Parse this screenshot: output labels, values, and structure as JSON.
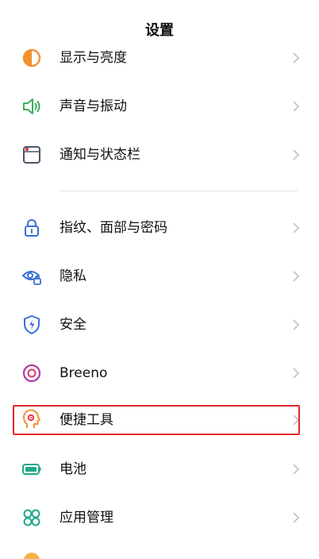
{
  "header": {
    "title": "设置"
  },
  "items": [
    {
      "label": "显示与亮度",
      "icon": "display-brightness-icon",
      "color": "#f2922e"
    },
    {
      "label": "声音与振动",
      "icon": "speaker-icon",
      "color": "#3daa5c"
    },
    {
      "label": "通知与状态栏",
      "icon": "notification-icon",
      "color": "#4a5666"
    },
    {
      "label": "指纹、面部与密码",
      "icon": "lock-icon",
      "color": "#3b6fd6"
    },
    {
      "label": "隐私",
      "icon": "privacy-eye-icon",
      "color": "#3b6fd6"
    },
    {
      "label": "安全",
      "icon": "security-shield-icon",
      "color": "#3b6fd6"
    },
    {
      "label": "Breeno",
      "icon": "breeno-icon",
      "color": "#b03aa8"
    },
    {
      "label": "便捷工具",
      "icon": "convenience-tools-icon",
      "color": "#f2922e"
    },
    {
      "label": "电池",
      "icon": "battery-icon",
      "color": "#1fa889"
    },
    {
      "label": "应用管理",
      "icon": "app-management-icon",
      "color": "#1fa889"
    }
  ],
  "colors": {
    "highlight_border": "#e8262b",
    "chevron": "#c4c4c4",
    "divider": "#e3e3e3"
  }
}
